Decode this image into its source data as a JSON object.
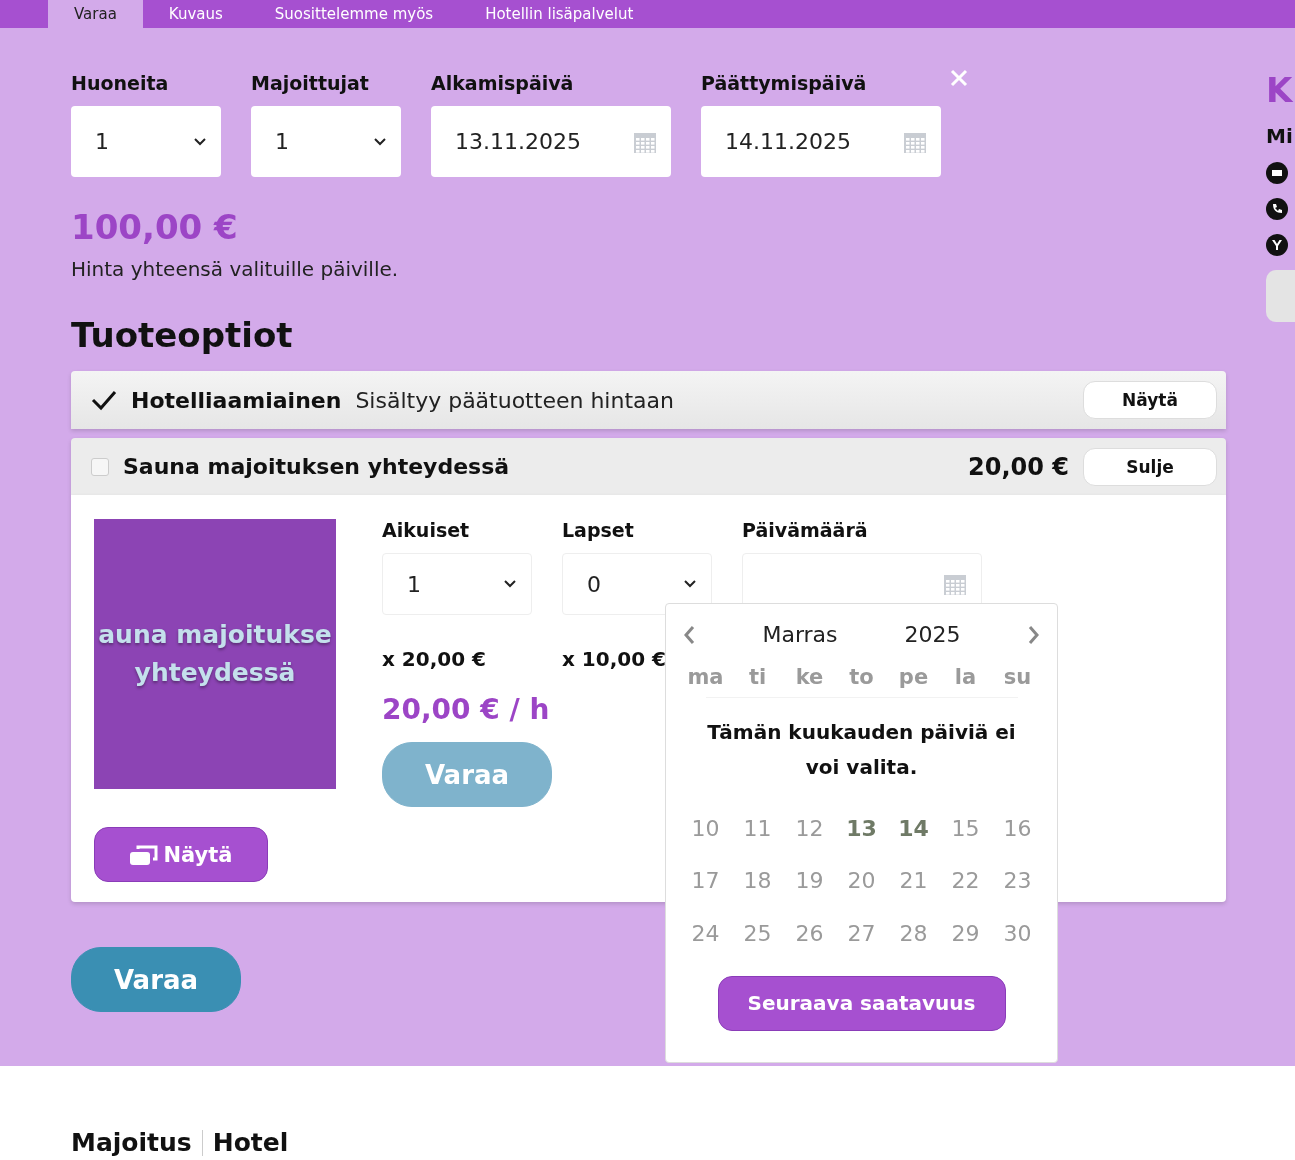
{
  "tabs": [
    {
      "label": "Varaa",
      "selected": true
    },
    {
      "label": "Kuvaus",
      "selected": false
    },
    {
      "label": "Suosittelemme myös",
      "selected": false
    },
    {
      "label": "Hotellin lisäpalvelut",
      "selected": false
    }
  ],
  "booking": {
    "fields": [
      {
        "label": "Huoneita",
        "kind": "select",
        "value": "1"
      },
      {
        "label": "Majoittujat",
        "kind": "select",
        "value": "1"
      },
      {
        "label": "Alkamispäivä",
        "kind": "date",
        "value": "13.11.2025"
      },
      {
        "label": "Päättymispäivä",
        "kind": "date",
        "value": "14.11.2025"
      }
    ],
    "price": "100,00 €",
    "price_note": "Hinta yhteensä valituille päiville."
  },
  "options_title": "Tuoteoptiot",
  "options": [
    {
      "kind": "included",
      "checked": true,
      "name": "Hotelliaamiainen",
      "description": "Sisältyy päätuotteen hintaan",
      "button": "Näytä"
    },
    {
      "kind": "expanded",
      "checked": false,
      "name": "Sauna majoituksen yhteydessä",
      "price": "20,00 €",
      "button": "Sulje",
      "detail": {
        "image_title": [
          "auna majoitukse",
          "yhteydessä"
        ],
        "show_button": "Näytä",
        "fields": [
          {
            "label": "Aikuiset",
            "kind": "select",
            "value": "1",
            "unit_price": "x 20,00 €"
          },
          {
            "label": "Lapset",
            "kind": "select",
            "value": "0",
            "unit_price": "x 10,00 €"
          },
          {
            "label": "Päivämäärä",
            "kind": "date"
          }
        ],
        "total": "20,00 € / h",
        "book_button": "Varaa"
      }
    }
  ],
  "calendar": {
    "month": "Marras",
    "year": "2025",
    "weekdays": [
      "ma",
      "ti",
      "ke",
      "to",
      "pe",
      "la",
      "su"
    ],
    "weeks": [
      [
        {
          "day": "10",
          "highlighted": false
        },
        {
          "day": "11",
          "highlighted": false
        },
        {
          "day": "12",
          "highlighted": false
        },
        {
          "day": "13",
          "highlighted": true
        },
        {
          "day": "14",
          "highlighted": true
        },
        {
          "day": "15",
          "highlighted": false
        },
        {
          "day": "16",
          "highlighted": false
        }
      ],
      [
        {
          "day": "17",
          "highlighted": false
        },
        {
          "day": "18",
          "highlighted": false
        },
        {
          "day": "19",
          "highlighted": false
        },
        {
          "day": "20",
          "highlighted": false
        },
        {
          "day": "21",
          "highlighted": false
        },
        {
          "day": "22",
          "highlighted": false
        },
        {
          "day": "23",
          "highlighted": false
        }
      ],
      [
        {
          "day": "24",
          "highlighted": false
        },
        {
          "day": "25",
          "highlighted": false
        },
        {
          "day": "26",
          "highlighted": false
        },
        {
          "day": "27",
          "highlighted": false
        },
        {
          "day": "28",
          "highlighted": false
        },
        {
          "day": "29",
          "highlighted": false
        },
        {
          "day": "30",
          "highlighted": false
        }
      ]
    ],
    "message": "Tämän kuukauden päiviä ei voi valita.",
    "next_button": "Seuraava saatavuus"
  },
  "book_button": "Varaa",
  "sidebar": {
    "heading": "K",
    "subheading": "Mi"
  },
  "footer": {
    "breadcrumb": [
      "Majoitus",
      "Hotel"
    ]
  }
}
